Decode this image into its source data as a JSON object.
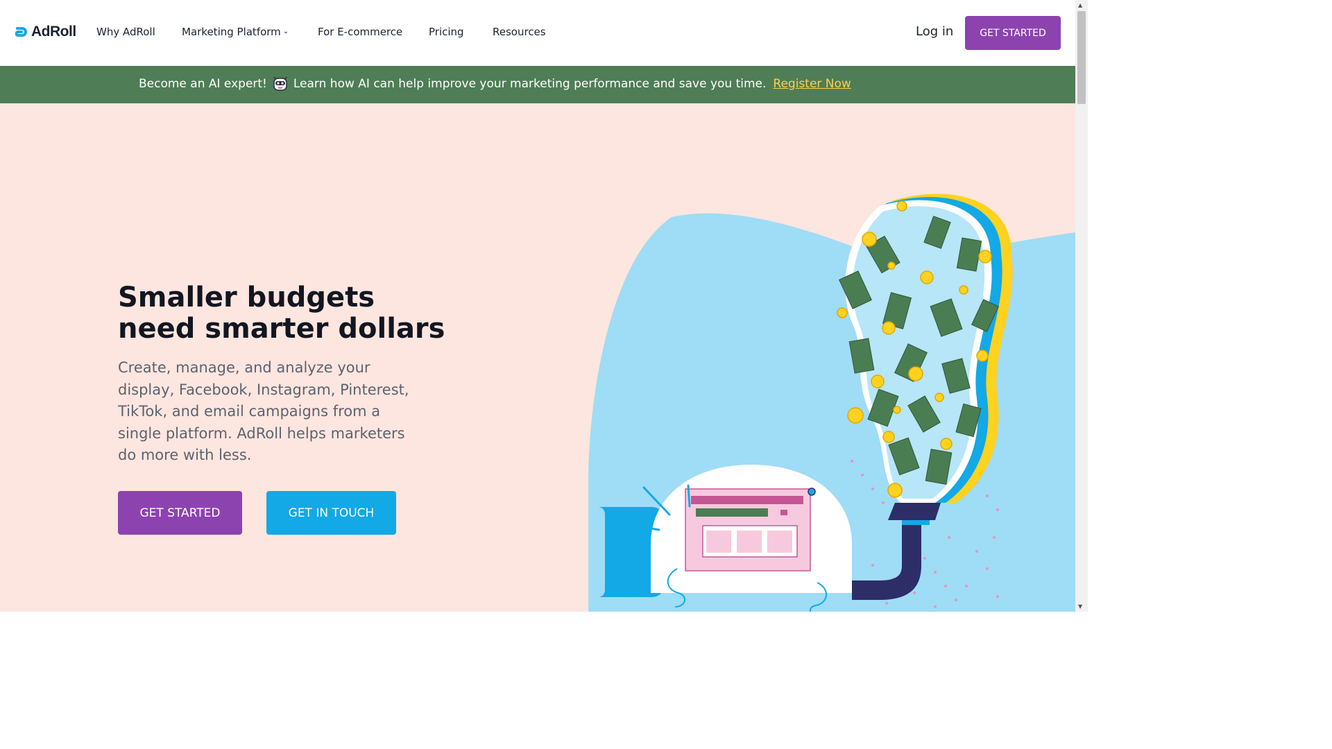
{
  "brand": {
    "name": "AdRoll",
    "accent": "#8c43b0",
    "secondary": "#12a9e6",
    "banner_bg": "#4f7d56"
  },
  "nav": {
    "links": [
      {
        "label": "Why AdRoll"
      },
      {
        "label": "Marketing Platform",
        "has_dropdown": true
      },
      {
        "label": "For E-commerce"
      },
      {
        "label": "Pricing"
      },
      {
        "label": "Resources"
      }
    ],
    "login": "Log in",
    "cta": "GET STARTED"
  },
  "banner": {
    "text_before": "Become an AI expert!",
    "emoji_icon": "robot-face-icon",
    "text_after": "Learn how AI can help improve your marketing performance and save you time.",
    "link": "Register Now"
  },
  "hero": {
    "title": "Smaller budgets need smarter dollars",
    "description": "Create, manage, and analyze your display, Facebook, Instagram, Pinterest, TikTok, and email campaigns from a single platform. AdRoll helps marketers do more with less.",
    "primary_cta": "GET STARTED",
    "secondary_cta": "GET IN TOUCH"
  }
}
